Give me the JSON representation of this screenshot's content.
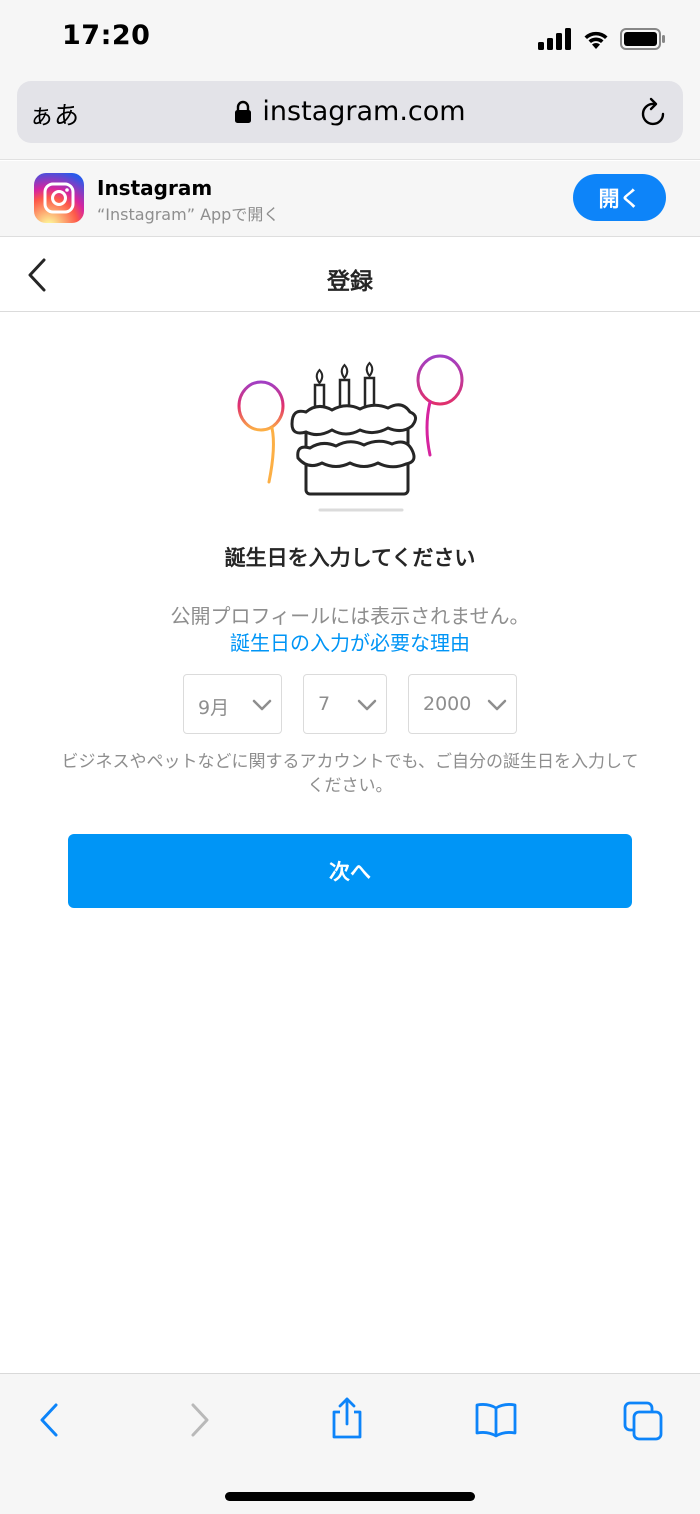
{
  "status_bar": {
    "time": "17:20"
  },
  "browser": {
    "text_size_label": "ぁあ",
    "url": "instagram.com"
  },
  "app_banner": {
    "name": "Instagram",
    "subtitle": "“Instagram” Appで開く",
    "open_label": "開く"
  },
  "header": {
    "title": "登録"
  },
  "main": {
    "heading": "誕生日を入力してください",
    "info_text": "公開プロフィールには表示されません。",
    "info_link": "誕生日の入力が必要な理由",
    "month_value": "9月",
    "day_value": "7",
    "year_value": "2000",
    "note": "ビジネスやペットなどに関するアカウントでも、ご自分の誕生日を入力してください。",
    "next_label": "次へ"
  },
  "colors": {
    "accent": "#0095f6",
    "safari_blue": "#0d84f9",
    "muted_text": "#8e8e8e"
  },
  "icons": [
    "signal-icon",
    "wifi-icon",
    "battery-icon",
    "lock-icon",
    "reload-icon",
    "back-chevron-icon",
    "chevron-down-icon",
    "share-icon",
    "bookmarks-icon",
    "tabs-icon",
    "forward-icon"
  ]
}
